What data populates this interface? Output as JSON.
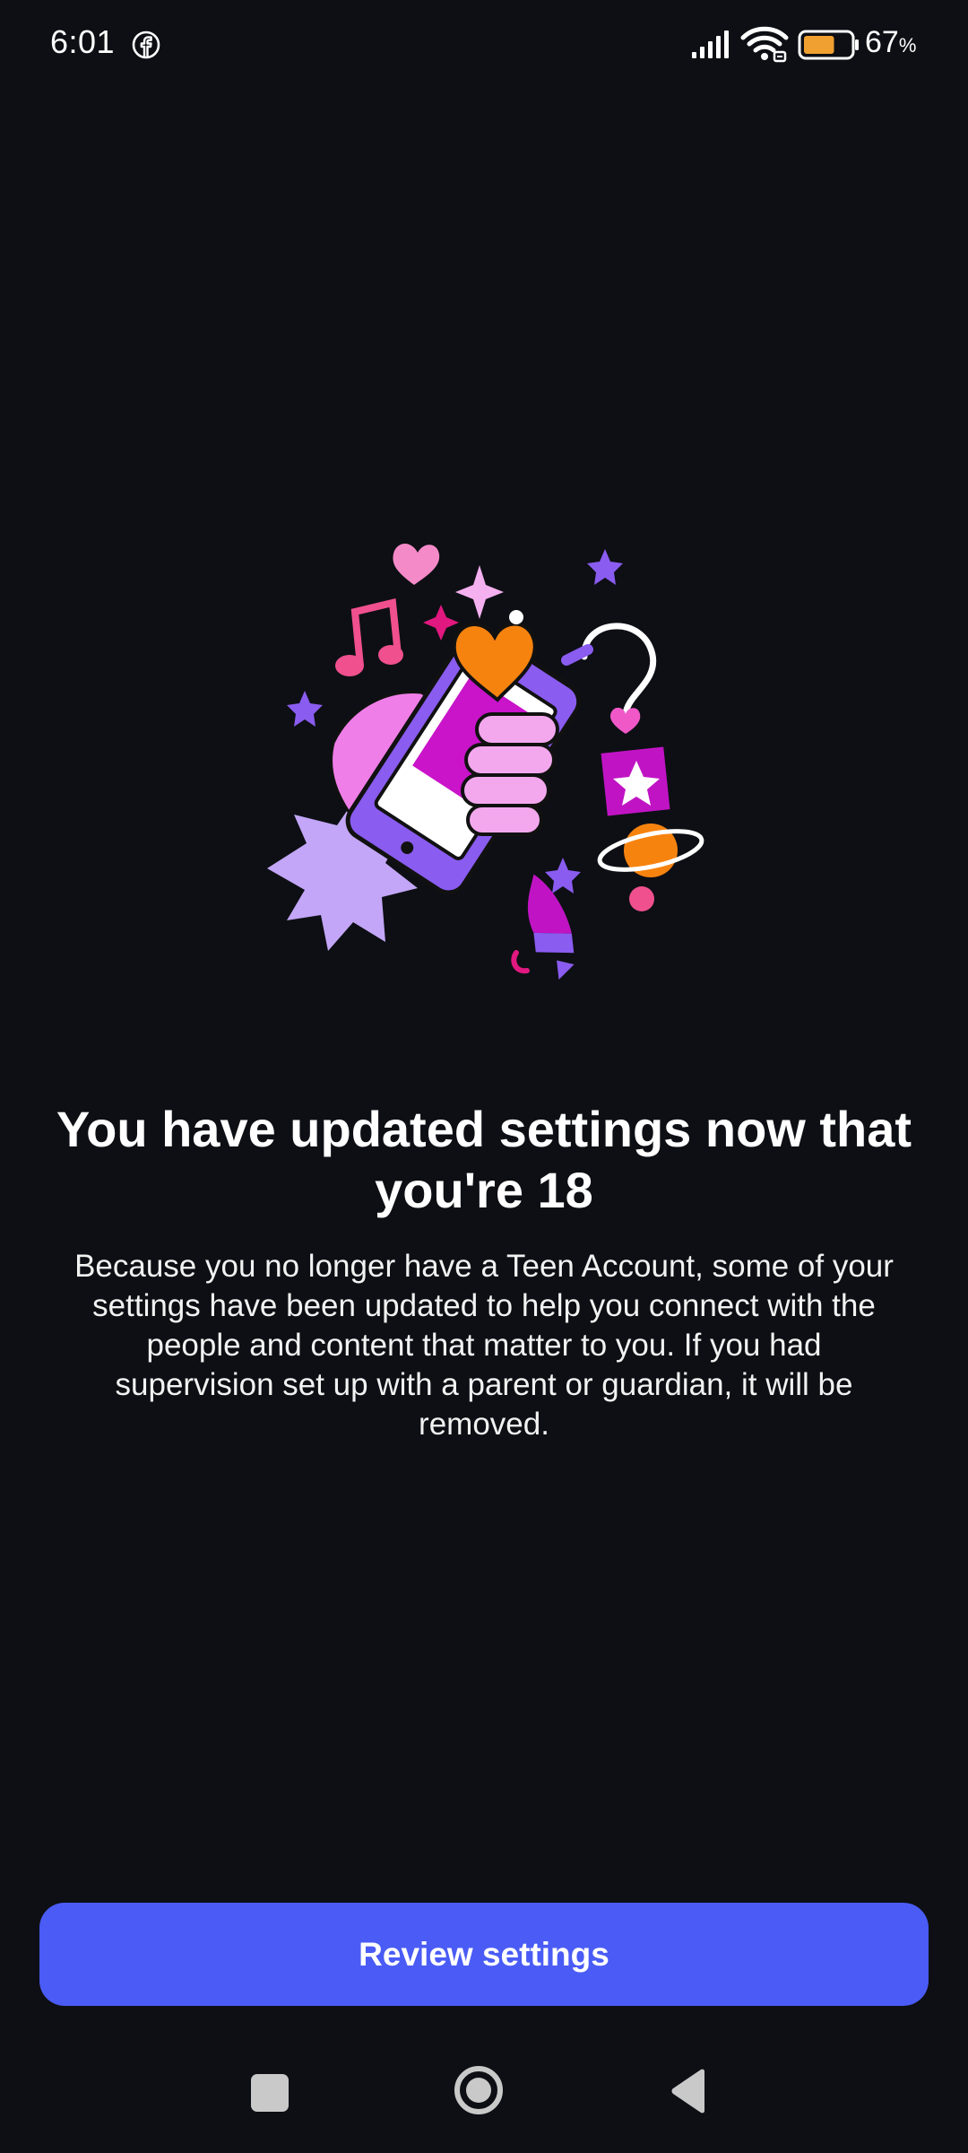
{
  "status_bar": {
    "time": "6:01",
    "app_icon": "facebook-icon",
    "signal_icon": "signal-bars-icon",
    "wifi_icon": "wifi-icon",
    "battery_icon": "battery-icon",
    "battery_percent": "67",
    "battery_percent_sign": "%",
    "battery_level": 0.67
  },
  "illustration": {
    "icon": "teen-phone-celebration-illustration"
  },
  "main": {
    "title": "You have updated settings now that you're 18",
    "body": "Because you no longer have a Teen Account, some of your settings have been updated to help you connect with the people and content that matter to you. If you had supervision set up with a parent or guardian, it will be removed."
  },
  "actions": {
    "review_label": "Review settings"
  },
  "nav_bar": {
    "recents_icon": "square-recents-icon",
    "home_icon": "circle-home-icon",
    "back_icon": "triangle-back-icon"
  },
  "colors": {
    "background": "#0d0f14",
    "button": "#4a5cf5",
    "battery_fill": "#f0a030"
  }
}
